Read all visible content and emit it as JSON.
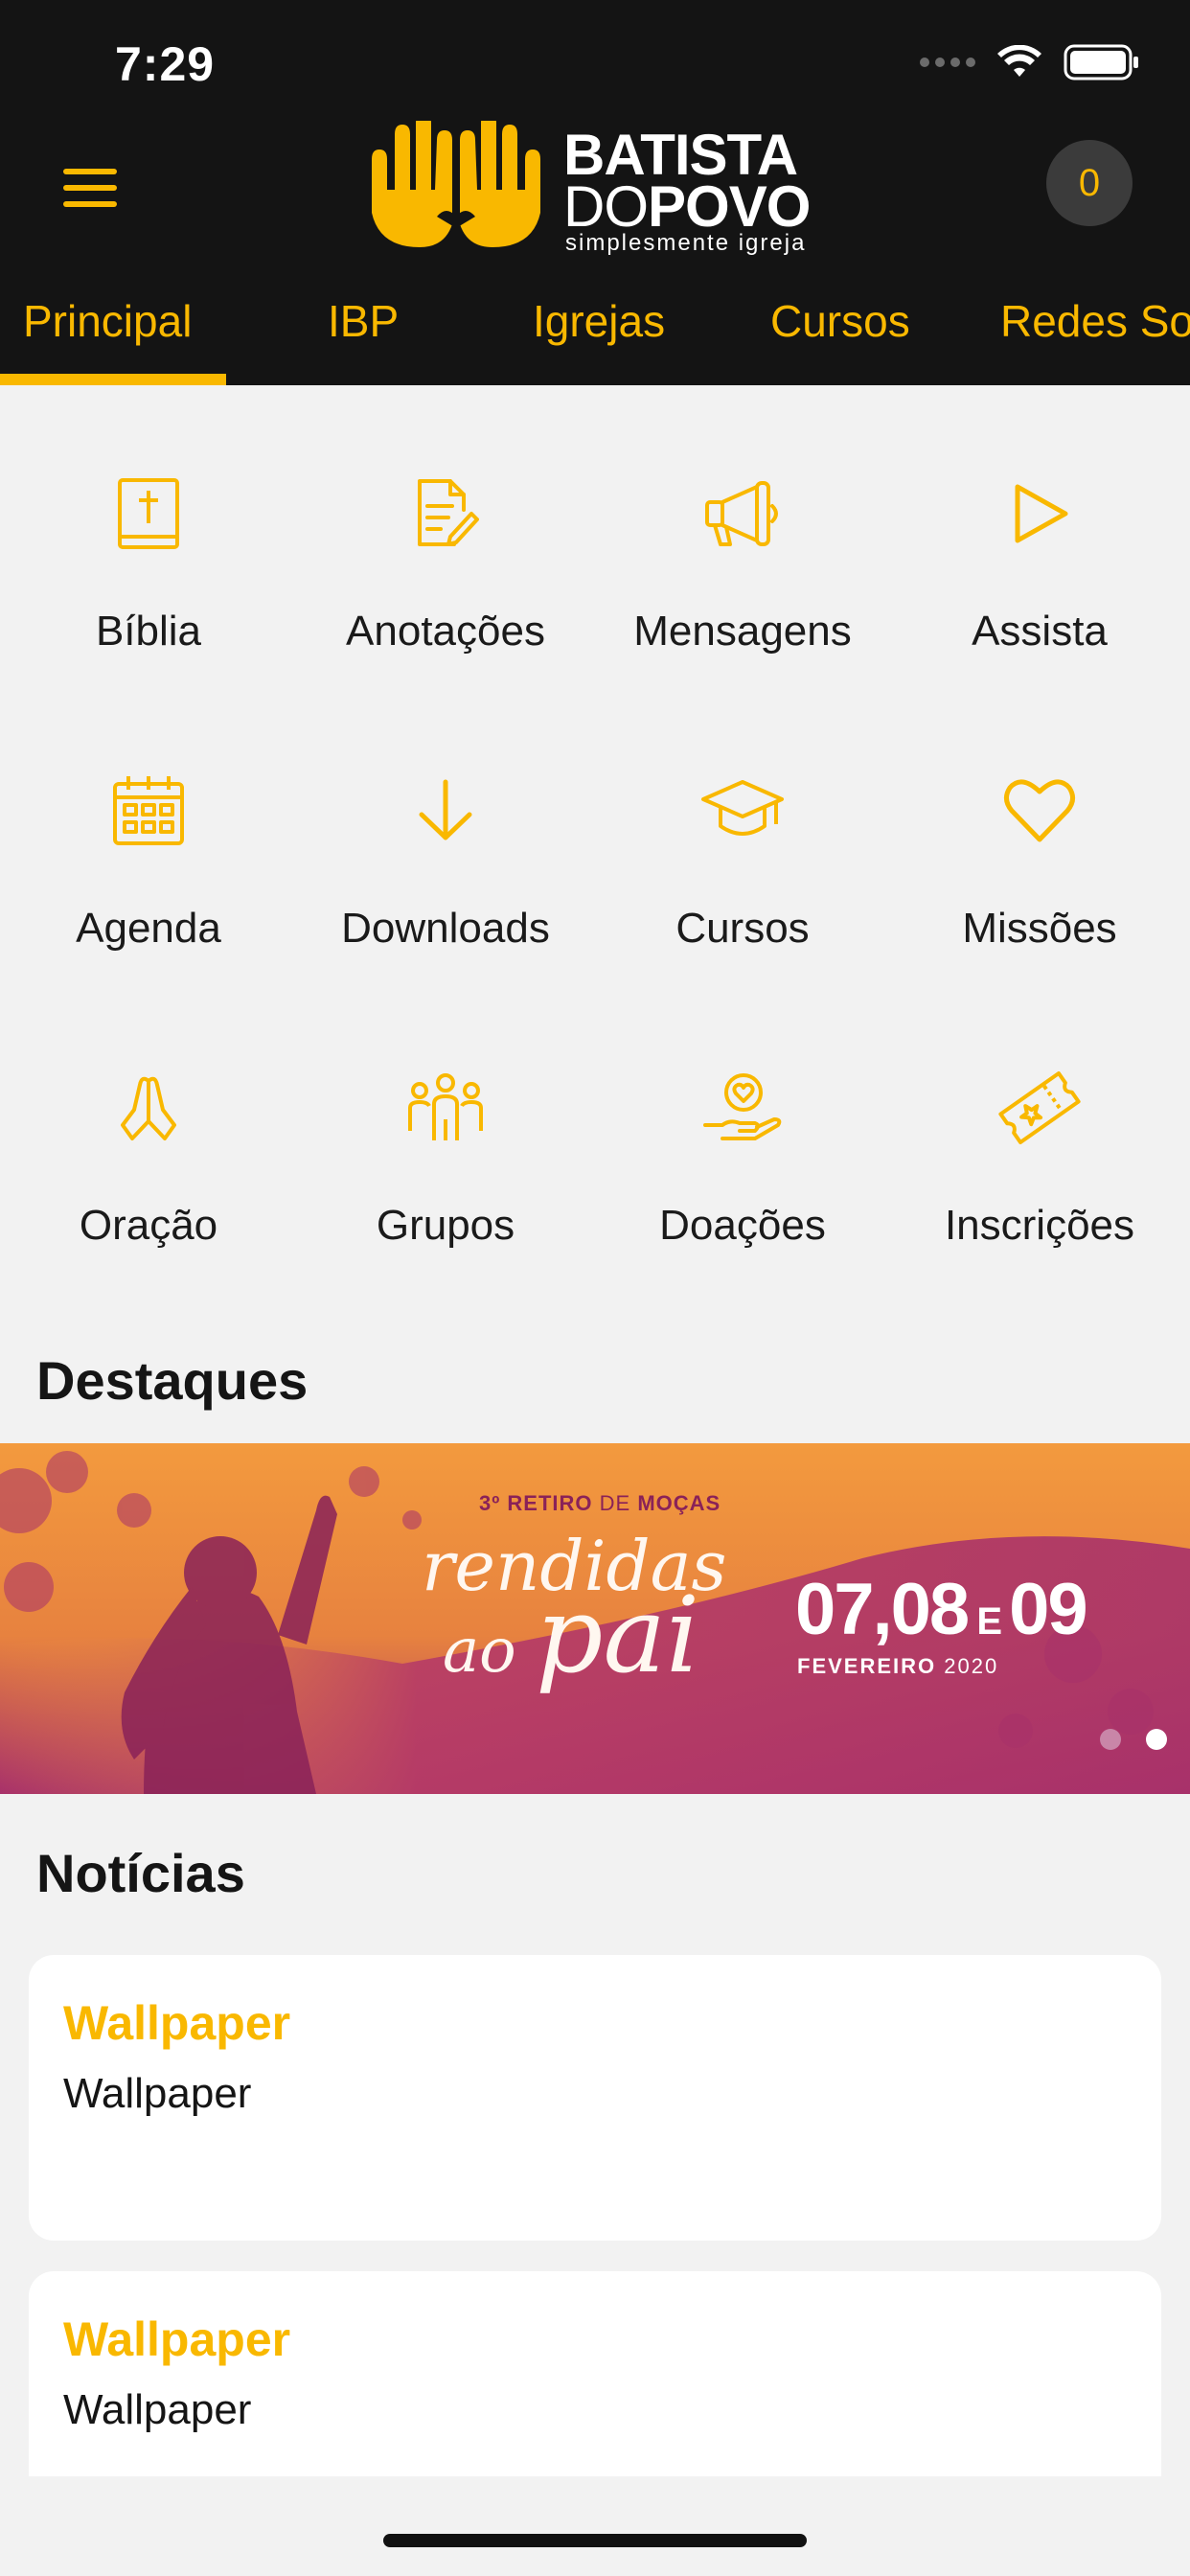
{
  "status_bar": {
    "time": "7:29"
  },
  "header": {
    "brand": {
      "line1": "BATISTA",
      "line2_light": "DO",
      "line2_bold": "POVO",
      "tagline": "simplesmente igreja"
    },
    "cart_count": "0"
  },
  "tabs": [
    {
      "label": "Principal",
      "active": true
    },
    {
      "label": "IBP"
    },
    {
      "label": "Igrejas"
    },
    {
      "label": "Cursos"
    },
    {
      "label": "Redes So"
    }
  ],
  "shortcuts": [
    {
      "label": "Bíblia",
      "icon": "bible-icon"
    },
    {
      "label": "Anotações",
      "icon": "notes-icon"
    },
    {
      "label": "Mensagens",
      "icon": "megaphone-icon"
    },
    {
      "label": "Assista",
      "icon": "play-icon"
    },
    {
      "label": "Agenda",
      "icon": "calendar-icon"
    },
    {
      "label": "Downloads",
      "icon": "download-icon"
    },
    {
      "label": "Cursos",
      "icon": "graduation-cap-icon"
    },
    {
      "label": "Missões",
      "icon": "heart-icon"
    },
    {
      "label": "Oração",
      "icon": "praying-hands-icon"
    },
    {
      "label": "Grupos",
      "icon": "group-icon"
    },
    {
      "label": "Doações",
      "icon": "donation-hand-icon"
    },
    {
      "label": "Inscrições",
      "icon": "ticket-icon"
    }
  ],
  "highlights": {
    "title": "Destaques",
    "banner": {
      "kicker_bold": "3º RETIRO",
      "kicker_light": "DE",
      "kicker_end": "MOÇAS",
      "script_line1": "rendidas",
      "script_line2a": "ao",
      "script_line2b": "pai",
      "dates_a": "07,08",
      "dates_e": "E",
      "dates_b": "09",
      "month": "FEVEREIRO",
      "year": "2020"
    },
    "page_count": 2,
    "active_page": 2
  },
  "news": {
    "title": "Notícias",
    "items": [
      {
        "title": "Wallpaper",
        "subtitle": "Wallpaper"
      },
      {
        "title": "Wallpaper",
        "subtitle": "Wallpaper"
      }
    ]
  },
  "colors": {
    "accent": "#f9b800",
    "header_bg": "#141414",
    "page_bg": "#f2f2f2",
    "card_bg": "#ffffff",
    "banner_orange": "#f39a3e",
    "banner_magenta": "#a8316a"
  }
}
